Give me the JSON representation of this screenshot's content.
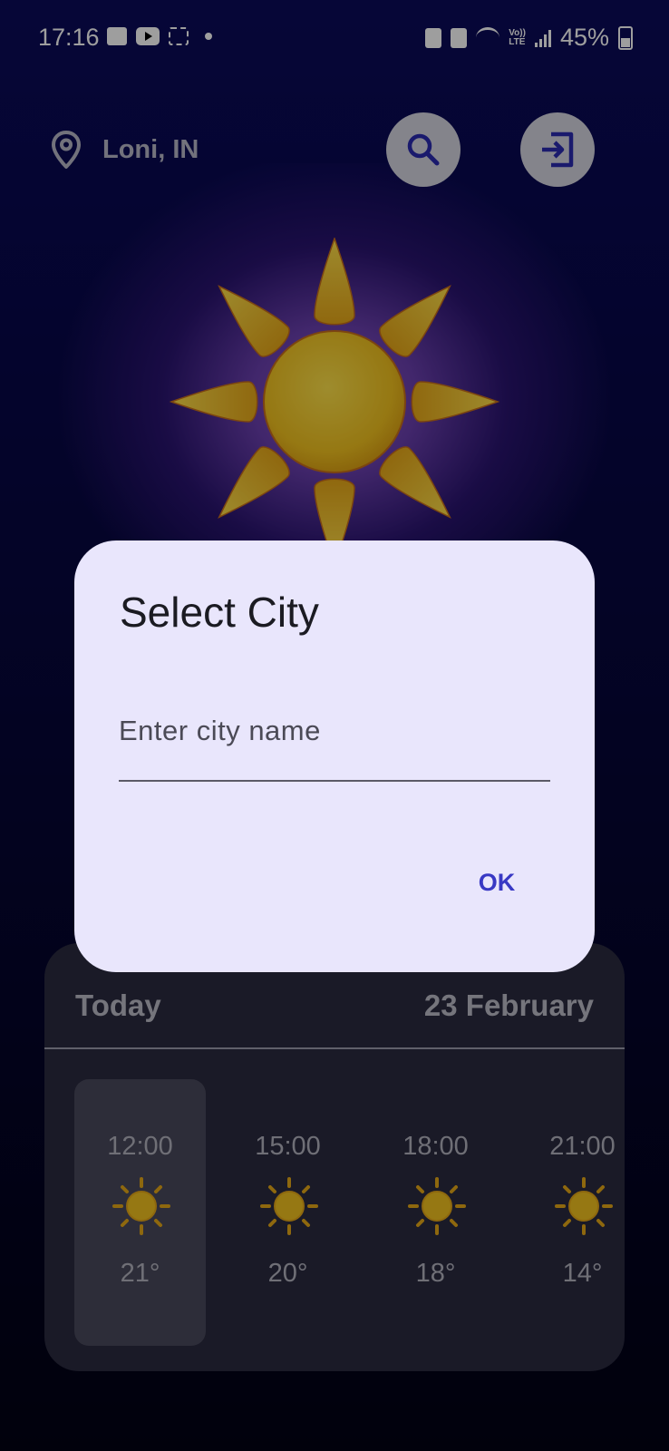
{
  "status_bar": {
    "time": "17:16",
    "battery": "45%"
  },
  "header": {
    "location": "Loni, IN",
    "search_icon": "search-icon",
    "logout_icon": "logout-icon"
  },
  "weather": {
    "main_icon": "sun-icon"
  },
  "forecast": {
    "today_label": "Today",
    "date": "23 February",
    "hours": [
      {
        "time": "12:00",
        "temp": "21°",
        "icon": "sun-icon",
        "selected": true
      },
      {
        "time": "15:00",
        "temp": "20°",
        "icon": "sun-icon",
        "selected": false
      },
      {
        "time": "18:00",
        "temp": "18°",
        "icon": "sun-icon",
        "selected": false
      },
      {
        "time": "21:00",
        "temp": "14°",
        "icon": "sun-icon",
        "selected": false
      }
    ]
  },
  "dialog": {
    "title": "Select City",
    "input_placeholder": "Enter city name",
    "input_value": "",
    "ok_label": "OK"
  },
  "colors": {
    "dialog_bg": "#e9e6fc",
    "accent": "#3838c4",
    "background": "#0a0a5a",
    "sun": "#e6c12a"
  }
}
